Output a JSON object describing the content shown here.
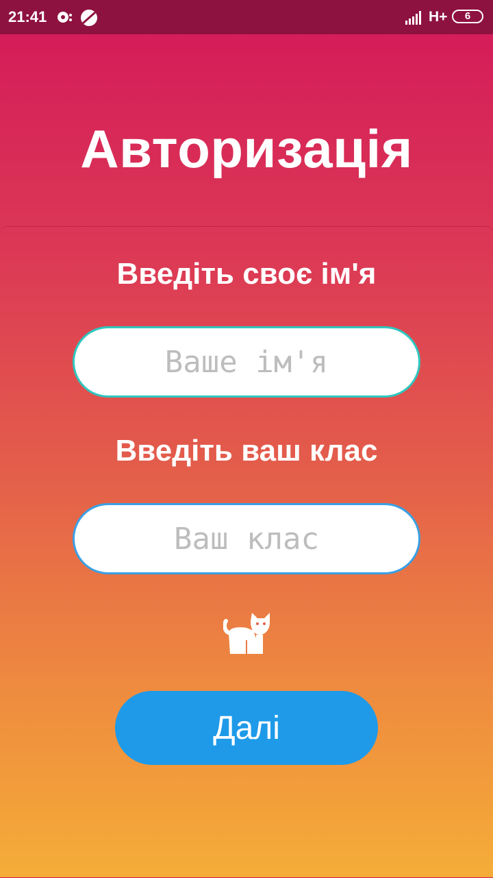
{
  "status_bar": {
    "time": "21:41",
    "network": "H+",
    "battery": "6",
    "icons": [
      "notification-icon",
      "vpn-icon",
      "signal-icon",
      "battery-icon"
    ]
  },
  "page": {
    "title": "Авторизація"
  },
  "form": {
    "name_label": "Введіть своє ім'я",
    "name_placeholder": "Ваше ім'я",
    "class_label": "Введіть ваш клас",
    "class_placeholder": "Ваш клас",
    "mascot_icon": "cat-icon",
    "next_label": "Далі"
  },
  "colors": {
    "status_bar": "#8e1240",
    "gradient_top": "#d3185a",
    "gradient_bottom": "#f5ad38",
    "button": "#1e9ae9",
    "name_field_border": "#2fc7bf",
    "class_field_border": "#3aa0e4"
  }
}
